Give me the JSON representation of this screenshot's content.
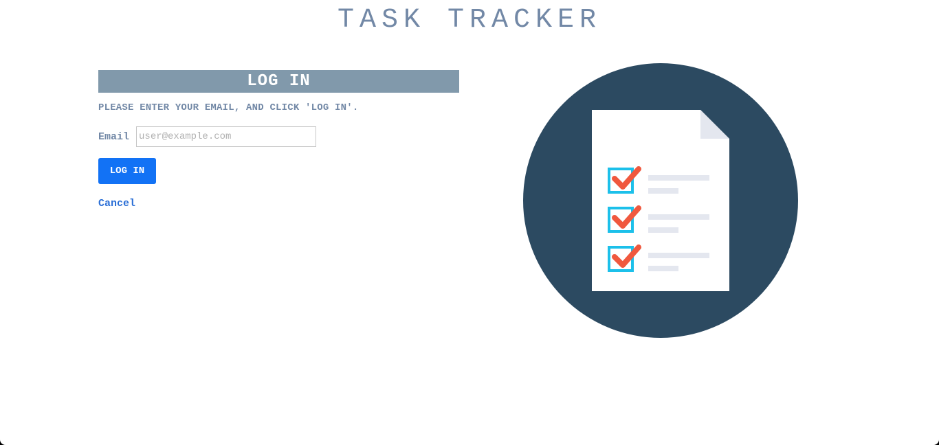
{
  "app": {
    "title": "TASK TRACKER"
  },
  "login": {
    "header": "LOG IN",
    "instructions": "PLEASE ENTER YOUR EMAIL, AND CLICK 'LOG IN'.",
    "email_label": "Email",
    "email_value": "",
    "email_placeholder": "user@example.com",
    "submit_label": "LOG IN",
    "cancel_label": "Cancel"
  },
  "colors": {
    "title": "#7288a6",
    "header_bg": "#8199ab",
    "button_bg": "#1272f5",
    "link": "#2b6fd6",
    "circle": "#2c4a61",
    "checkbox": "#1cc0ea",
    "checkmark": "#f0583e",
    "line": "#e4e7ef"
  },
  "illustration": {
    "icon": "checklist-document-icon",
    "checked_items": 3
  }
}
